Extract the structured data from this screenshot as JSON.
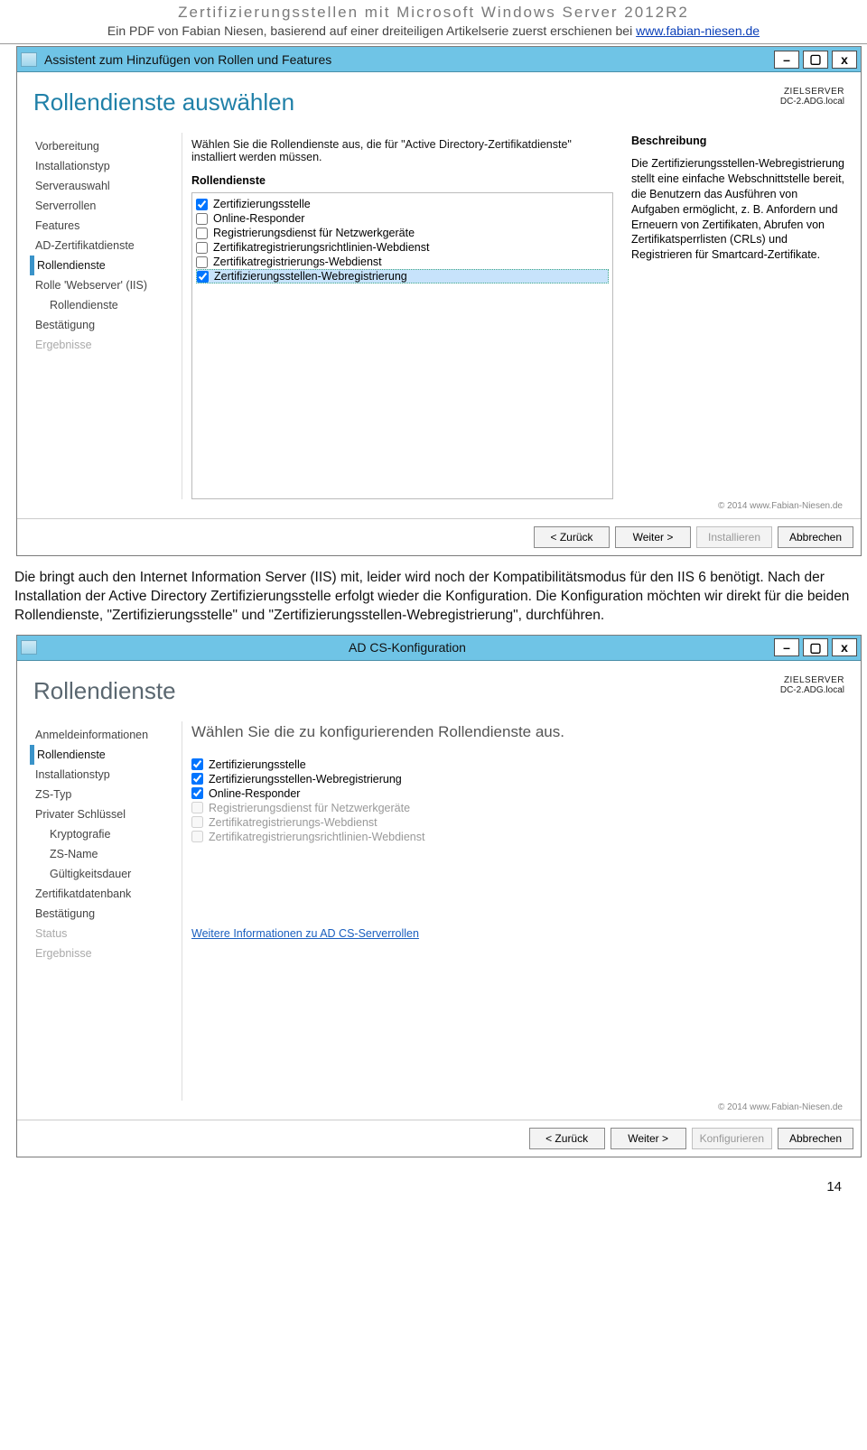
{
  "doc": {
    "title": "Zertifizierungsstellen mit Microsoft Windows Server 2012R2",
    "subtitle_prefix": "Ein PDF von Fabian Niesen, basierend auf einer dreiteiligen Artikelserie zuerst erschienen bei ",
    "subtitle_link": "www.fabian-niesen.de",
    "page_number": "14"
  },
  "wiz1": {
    "title": "Assistent zum Hinzufügen von Rollen und Features",
    "heading": "Rollendienste auswählen",
    "target_label": "ZIELSERVER",
    "target_value": "DC-2.ADG.local",
    "nav": [
      {
        "label": "Vorbereitung"
      },
      {
        "label": "Installationstyp"
      },
      {
        "label": "Serverauswahl"
      },
      {
        "label": "Serverrollen"
      },
      {
        "label": "Features"
      },
      {
        "label": "AD-Zertifikatdienste"
      },
      {
        "label": "Rollendienste",
        "sel": true,
        "sub": true
      },
      {
        "label": "Rolle 'Webserver' (IIS)"
      },
      {
        "label": "Rollendienste",
        "sub": true
      },
      {
        "label": "Bestätigung"
      },
      {
        "label": "Ergebnisse",
        "disabled": true
      }
    ],
    "instruction": "Wählen Sie die Rollendienste aus, die für \"Active Directory-Zertifikatdienste\" installiert werden müssen.",
    "group_label": "Rollendienste",
    "items": [
      {
        "label": "Zertifizierungsstelle",
        "checked": true
      },
      {
        "label": "Online-Responder",
        "checked": false
      },
      {
        "label": "Registrierungsdienst für Netzwerkgeräte",
        "checked": false
      },
      {
        "label": "Zertifikatregistrierungsrichtlinien-Webdienst",
        "checked": false
      },
      {
        "label": "Zertifikatregistrierungs-Webdienst",
        "checked": false
      },
      {
        "label": "Zertifizierungsstellen-Webregistrierung",
        "checked": true,
        "sel": true
      }
    ],
    "desc_label": "Beschreibung",
    "desc_text": "Die Zertifizierungsstellen-Webregistrierung stellt eine einfache Webschnittstelle bereit, die Benutzern das Ausführen von Aufgaben ermöglicht, z. B. Anfordern und Erneuern von Zertifikaten, Abrufen von Zertifikatsperrlisten (CRLs) und Registrieren für Smartcard-Zertifikate.",
    "watermark": "© 2014 www.Fabian-Niesen.de",
    "buttons": {
      "back": "< Zurück",
      "next": "Weiter >",
      "install": "Installieren",
      "cancel": "Abbrechen"
    }
  },
  "article": "Die bringt auch den Internet Information Server (IIS) mit, leider wird noch der Kompatibilitätsmodus für den IIS 6 benötigt. Nach der Installation der Active Directory Zertifizierungsstelle  erfolgt wieder die Konfiguration. Die Konfiguration möchten wir direkt für die beiden Rollendienste, \"Zertifizierungsstelle\" und \"Zertifizierungsstellen-Webregistrierung\", durchführen.",
  "wiz2": {
    "title": "AD CS-Konfiguration",
    "heading": "Rollendienste",
    "target_label": "ZIELSERVER",
    "target_value": "DC-2.ADG.local",
    "nav": [
      {
        "label": "Anmeldeinformationen"
      },
      {
        "label": "Rollendienste",
        "sel": true
      },
      {
        "label": "Installationstyp"
      },
      {
        "label": "ZS-Typ"
      },
      {
        "label": "Privater Schlüssel"
      },
      {
        "label": "Kryptografie",
        "sub": true
      },
      {
        "label": "ZS-Name",
        "sub": true
      },
      {
        "label": "Gültigkeitsdauer",
        "sub": true
      },
      {
        "label": "Zertifikatdatenbank"
      },
      {
        "label": "Bestätigung"
      },
      {
        "label": "Status",
        "disabled": true
      },
      {
        "label": "Ergebnisse",
        "disabled": true
      }
    ],
    "sub_instruction": "Wählen Sie die zu konfigurierenden Rollendienste aus.",
    "items": [
      {
        "label": "Zertifizierungsstelle",
        "checked": true
      },
      {
        "label": "Zertifizierungsstellen-Webregistrierung",
        "checked": true
      },
      {
        "label": "Online-Responder",
        "checked": true
      },
      {
        "label": "Registrierungsdienst für Netzwerkgeräte",
        "checked": false,
        "disabled": true
      },
      {
        "label": "Zertifikatregistrierungs-Webdienst",
        "checked": false,
        "disabled": true
      },
      {
        "label": "Zertifikatregistrierungsrichtlinien-Webdienst",
        "checked": false,
        "disabled": true
      }
    ],
    "more_link": "Weitere Informationen zu AD CS-Serverrollen",
    "watermark": "© 2014 www.Fabian-Niesen.de",
    "buttons": {
      "back": "< Zurück",
      "next": "Weiter >",
      "configure": "Konfigurieren",
      "cancel": "Abbrechen"
    }
  }
}
